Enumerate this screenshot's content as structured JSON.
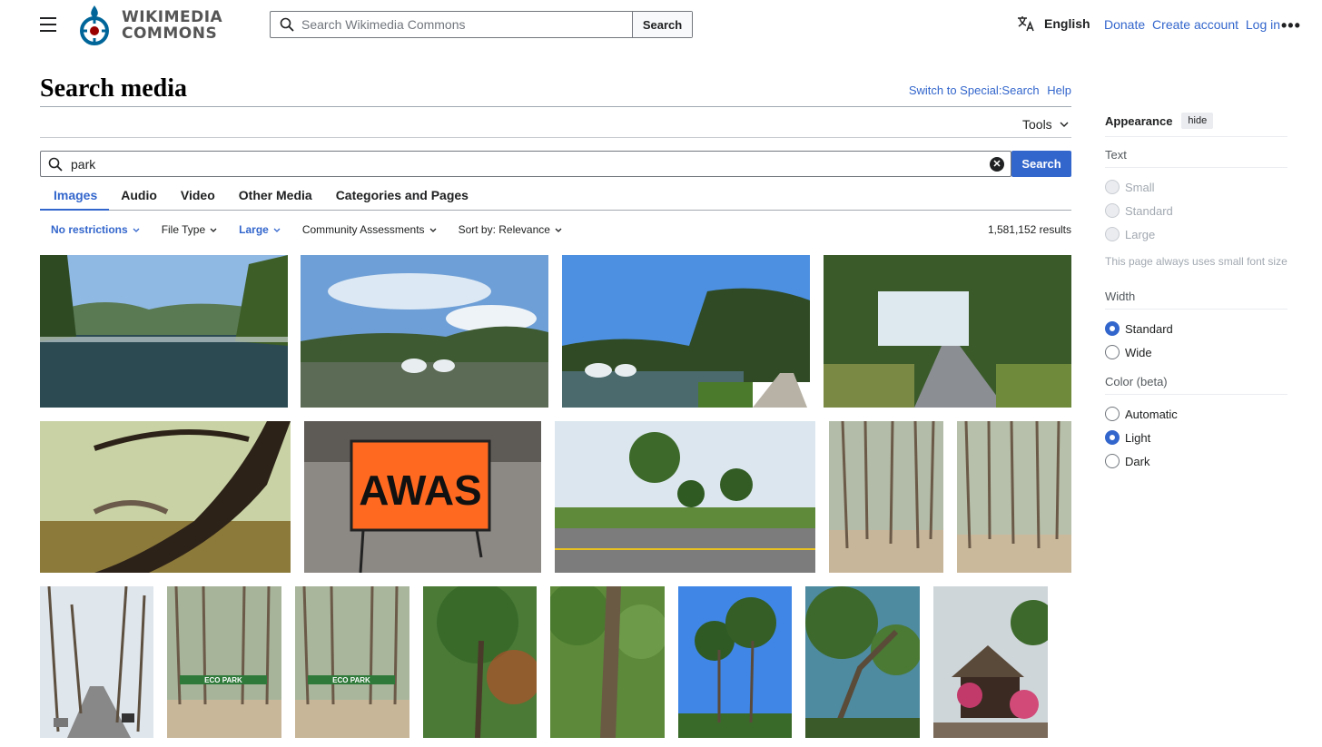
{
  "header": {
    "logo_line1": "WIKIMEDIA",
    "logo_line2": "COMMONS",
    "search_placeholder": "Search Wikimedia Commons",
    "search_button": "Search",
    "language": "English",
    "links": [
      "Donate",
      "Create account",
      "Log in"
    ]
  },
  "page": {
    "title": "Search media",
    "switch_link": "Switch to Special:Search",
    "help_link": "Help",
    "tools": "Tools"
  },
  "search": {
    "query": "park",
    "button": "Search"
  },
  "tabs": [
    "Images",
    "Audio",
    "Video",
    "Other Media",
    "Categories and Pages"
  ],
  "filters": [
    "No restrictions",
    "File Type",
    "Large",
    "Community Assessments",
    "Sort by: Relevance"
  ],
  "results_count": "1,581,152 results",
  "thumbnails": [
    {
      "subject": "lake with trees and hills"
    },
    {
      "subject": "pond with fountains"
    },
    {
      "subject": "pond with fountains and path"
    },
    {
      "subject": "tree-lined pathway"
    },
    {
      "subject": "arched bridge behind tree"
    },
    {
      "subject": "orange AWAS sign"
    },
    {
      "subject": "road by park fence"
    },
    {
      "subject": "pine forest"
    },
    {
      "subject": "pine forest"
    },
    {
      "subject": "pine-lined road"
    },
    {
      "subject": "eco park gate"
    },
    {
      "subject": "eco park gate"
    },
    {
      "subject": "tall tree"
    },
    {
      "subject": "tree trunk"
    },
    {
      "subject": "trees under blue sky"
    },
    {
      "subject": "tree over path"
    },
    {
      "subject": "thatched hut with flowers"
    }
  ],
  "awas_text": "AWAS",
  "eco_text": "ECO PARK",
  "appearance": {
    "title": "Appearance",
    "hide": "hide",
    "text_label": "Text",
    "text_options": [
      "Small",
      "Standard",
      "Large"
    ],
    "text_note": "This page always uses small font size",
    "width_label": "Width",
    "width_options": [
      "Standard",
      "Wide"
    ],
    "color_label": "Color (beta)",
    "color_options": [
      "Automatic",
      "Light",
      "Dark"
    ]
  },
  "colors": {
    "link": "#3366cc",
    "primary_button": "#3366cc"
  }
}
